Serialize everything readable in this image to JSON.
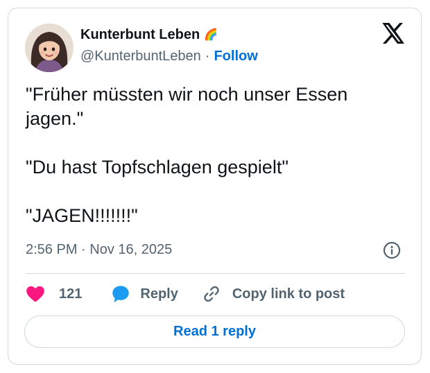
{
  "post": {
    "author_name": "Kunterbunt Leben",
    "author_emoji": "🌈",
    "handle": "@KunterbuntLeben",
    "separator": "·",
    "follow_label": "Follow",
    "lines": [
      "\"Früher müssten wir noch unser Essen jagen.\"",
      "\"Du hast Topfschlagen gespielt\"",
      "\"JAGEN!!!!!!!\""
    ],
    "timestamp": "2:56 PM · Nov 16, 2025"
  },
  "actions": {
    "like_count": "121",
    "reply_label": "Reply",
    "copy_label": "Copy link to post"
  },
  "read_replies_label": "Read 1 reply",
  "colors": {
    "accent": "#006fd6",
    "like": "#f91880",
    "reply_icon": "#1d9bf0",
    "muted_text": "#536471",
    "border": "#cfd9de"
  },
  "icons": [
    "x-logo-icon",
    "info-icon",
    "heart-icon",
    "reply-bubble-icon",
    "link-icon"
  ]
}
